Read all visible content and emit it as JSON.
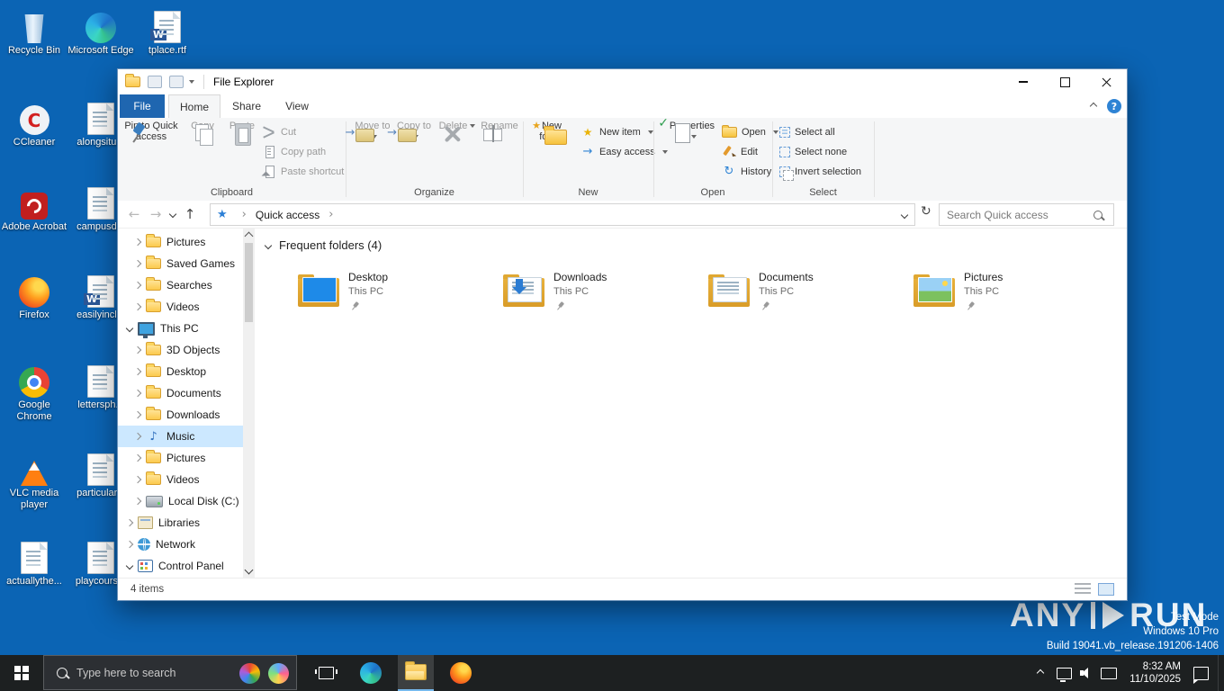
{
  "colors": {
    "desktop_background": "#0b64b4",
    "taskbar_background": "#1d2021",
    "selection_highlight": "#cce8ff",
    "file_tab_blue": "#1f66b0",
    "folder_yellow": "#f6c33c"
  },
  "icons": {
    "quick_access_star": "★",
    "music_note": "♪",
    "back_arrow": "←",
    "forward_arrow": "→",
    "up_arrow": "↑",
    "refresh": "↻",
    "breadcrumb_chevron": "›",
    "help": "?",
    "check": "✓",
    "new_item_star": "★",
    "easy_access_arrow": "→",
    "history_refresh": "↻",
    "move_arrow": "→",
    "word_badge": "W",
    "ccleaner_c": "C"
  },
  "desktop": {
    "icons": [
      "Recycle Bin",
      "Microsoft Edge",
      "tplace.rtf",
      "CCleaner",
      "Adobe Acrobat",
      "Firefox",
      "Google Chrome",
      "VLC media player",
      "actuallythe...",
      "alongsitu...",
      "campusd...",
      "easilyincl...",
      "lettersph...",
      "particular...",
      "playcours..."
    ]
  },
  "explorer": {
    "title": "File Explorer",
    "tabs": [
      "File",
      "Home",
      "Share",
      "View"
    ],
    "ribbon": {
      "clipboard": {
        "group_label": "Clipboard",
        "pin_to_quick_access": "Pin to Quick access",
        "copy": "Copy",
        "paste": "Paste",
        "cut": "Cut",
        "copy_path": "Copy path",
        "paste_shortcut": "Paste shortcut"
      },
      "organize": {
        "group_label": "Organize",
        "move_to": "Move to",
        "copy_to": "Copy to",
        "delete": "Delete",
        "rename": "Rename"
      },
      "new_group": {
        "group_label": "New",
        "new_folder": "New folder",
        "new_item": "New item",
        "easy_access": "Easy access"
      },
      "open_group": {
        "group_label": "Open",
        "properties": "Properties",
        "open": "Open",
        "edit": "Edit",
        "history": "History"
      },
      "select_group": {
        "group_label": "Select",
        "select_all": "Select all",
        "select_none": "Select none",
        "invert_selection": "Invert selection"
      }
    },
    "address": {
      "breadcrumb": "Quick access",
      "search_placeholder": "Search Quick access"
    },
    "sidebar": [
      "Pictures",
      "Saved Games",
      "Searches",
      "Videos",
      "This PC",
      "3D Objects",
      "Desktop",
      "Documents",
      "Downloads",
      "Music",
      "Pictures",
      "Videos",
      "Local Disk (C:)",
      "Libraries",
      "Network",
      "Control Panel"
    ],
    "content": {
      "section_header": "Frequent folders (4)",
      "tiles": [
        {
          "name": "Desktop",
          "location": "This PC"
        },
        {
          "name": "Downloads",
          "location": "This PC"
        },
        {
          "name": "Documents",
          "location": "This PC"
        },
        {
          "name": "Pictures",
          "location": "This PC"
        }
      ]
    },
    "status_bar": {
      "items_count": "4 items"
    }
  },
  "taskbar": {
    "search_placeholder": "Type here to search",
    "clock": {
      "time": "8:32 AM",
      "date": "11/10/2025"
    }
  },
  "watermark": {
    "brand_left": "ANY",
    "brand_right": "RUN",
    "line1": "Test Mode",
    "line2": "Windows 10 Pro",
    "line3": "Build 19041.vb_release.191206-1406"
  }
}
